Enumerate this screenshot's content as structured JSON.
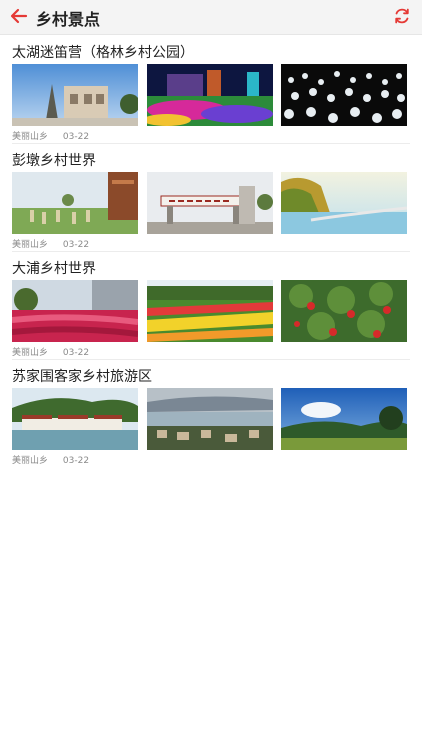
{
  "header": {
    "title": "乡村景点",
    "back_icon": "arrow-left-icon",
    "refresh_icon": "refresh-icon",
    "accent": "#e53935"
  },
  "spots": [
    {
      "title": "太湖迷笛营（格林乡村公园）",
      "source": "美丽山乡",
      "date": "03-22"
    },
    {
      "title": "彭墩乡村世界",
      "source": "美丽山乡",
      "date": "03-22"
    },
    {
      "title": "大浦乡村世界",
      "source": "美丽山乡",
      "date": "03-22"
    },
    {
      "title": "苏家围客家乡村旅游区",
      "source": "美丽山乡",
      "date": "03-22"
    }
  ]
}
